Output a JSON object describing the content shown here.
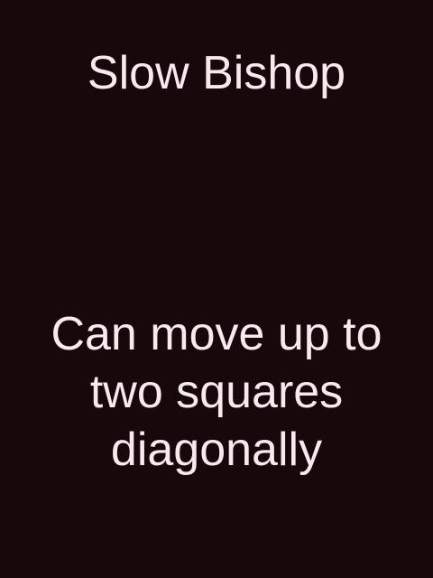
{
  "card": {
    "title": "Slow Bishop",
    "description_lines": [
      "Can move up to",
      "two squares",
      "diagonally"
    ]
  },
  "colors": {
    "background": "#16080b",
    "text": "#f7e9ee"
  }
}
